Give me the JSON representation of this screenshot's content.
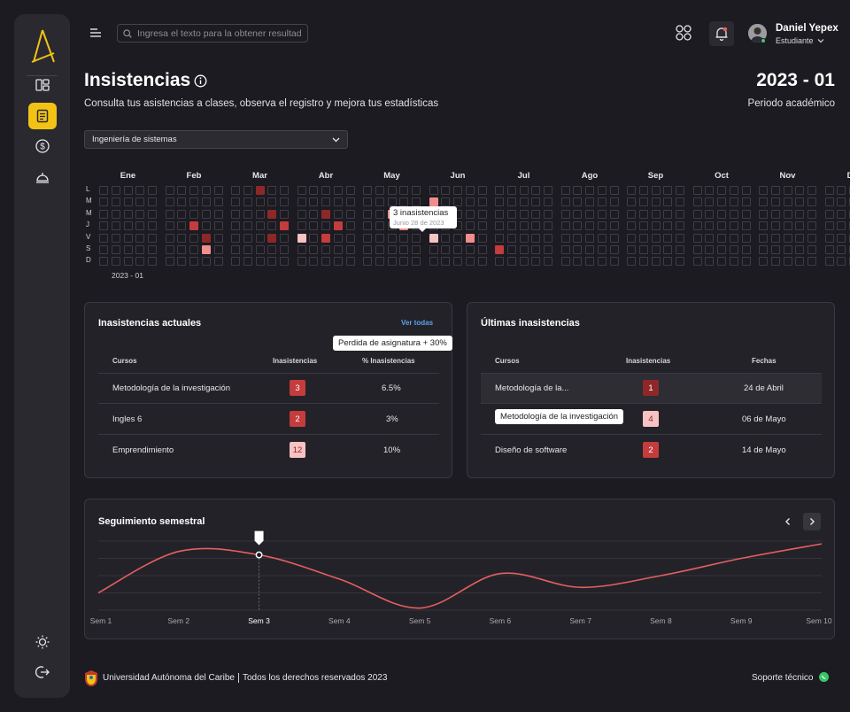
{
  "search": {
    "placeholder": "Ingresa el texto para la obtener resultados"
  },
  "user": {
    "name": "Daniel Yepex",
    "role": "Estudiante"
  },
  "header": {
    "title": "Insistencias",
    "subtitle": "Consulta tus asistencias a clases, observa el registro y mejora tus estadísticas",
    "period_value": "2023 - 01",
    "period_label": "Periodo académico"
  },
  "program_select": {
    "value": "Ingeniería de sistemas"
  },
  "heatmap": {
    "months": [
      "Ene",
      "Feb",
      "Mar",
      "Abr",
      "May",
      "Jun",
      "Jul",
      "Ago",
      "Sep",
      "Oct",
      "Nov",
      "Dic"
    ],
    "days": [
      "L",
      "M",
      "M",
      "J",
      "V",
      "S",
      "D"
    ],
    "year": "2023 - 01",
    "colors": {
      "dark": "#8e2828",
      "mid": "#c43c3c",
      "light": "#f08d8d",
      "pale": "#f6c2c2"
    },
    "highlighted": [
      {
        "col": 12,
        "row": 0,
        "level": "dark"
      },
      {
        "col": 25,
        "row": 1,
        "level": "light"
      },
      {
        "col": 13,
        "row": 2,
        "level": "dark"
      },
      {
        "col": 17,
        "row": 2,
        "level": "dark"
      },
      {
        "col": 22,
        "row": 2,
        "level": "light"
      },
      {
        "col": 7,
        "row": 3,
        "level": "mid"
      },
      {
        "col": 14,
        "row": 3,
        "level": "mid"
      },
      {
        "col": 18,
        "row": 3,
        "level": "mid"
      },
      {
        "col": 23,
        "row": 3,
        "level": "light"
      },
      {
        "col": 8,
        "row": 4,
        "level": "dark"
      },
      {
        "col": 13,
        "row": 4,
        "level": "dark"
      },
      {
        "col": 15,
        "row": 4,
        "level": "pale"
      },
      {
        "col": 17,
        "row": 4,
        "level": "mid"
      },
      {
        "col": 25,
        "row": 4,
        "level": "pale"
      },
      {
        "col": 28,
        "row": 4,
        "level": "light"
      },
      {
        "col": 8,
        "row": 5,
        "level": "light"
      },
      {
        "col": 30,
        "row": 5,
        "level": "mid"
      }
    ],
    "tooltip": {
      "title": "3 inasistencias",
      "date": "Junio 28 de 2023"
    }
  },
  "current_absences": {
    "title": "Inasistencias  actuales",
    "see_all": "Ver todas",
    "columns": [
      "Cursos",
      "Inasistencias",
      "% Inasistencias"
    ],
    "rows": [
      {
        "course": "Metodología de la investigación",
        "count": "3",
        "percent": "6.5%",
        "level": "mid"
      },
      {
        "course": "Ingles 6",
        "count": "2",
        "percent": "3%",
        "level": "mid"
      },
      {
        "course": "Emprendimiento",
        "count": "12",
        "percent": "10%",
        "level": "pale"
      }
    ],
    "tooltip": "Perdida de asignatura  + 30%"
  },
  "latest_absences": {
    "title": "Últimas inasistencias",
    "columns": [
      "Cursos",
      "Inasistencias",
      "Fechas"
    ],
    "rows": [
      {
        "course": "Metodología de la...",
        "count": "1",
        "date": "24 de Abril",
        "level": "dark"
      },
      {
        "course": "",
        "count": "4",
        "date": "06 de Mayo",
        "level": "pale"
      },
      {
        "course": "Diseño de software",
        "count": "2",
        "date": "14 de Mayo",
        "level": "mid"
      }
    ],
    "tooltip": "Metodología de la investigación"
  },
  "tracking": {
    "title": "Seguimiento semestral",
    "weeks": [
      "Sem 1",
      "Sem 2",
      "Sem 3",
      "Sem 4",
      "Sem 5",
      "Sem 6",
      "Sem 7",
      "Sem 8",
      "Sem 9",
      "Sem 10"
    ],
    "selected_week": "Sem 3",
    "line_color": "#e45f5f"
  },
  "chart_data": {
    "type": "line",
    "x": [
      "Sem 1",
      "Sem 2",
      "Sem 3",
      "Sem 4",
      "Sem 5",
      "Sem 6",
      "Sem 7",
      "Sem 8",
      "Sem 9",
      "Sem 10"
    ],
    "values": [
      0.25,
      0.85,
      0.8,
      0.45,
      0.03,
      0.53,
      0.33,
      0.5,
      0.75,
      0.96
    ],
    "ylim": [
      0,
      1
    ],
    "grid": true,
    "title": "Seguimiento semestral",
    "xlabel": "",
    "ylabel": ""
  },
  "footer": {
    "university": "Universidad Autónoma del Caribe",
    "rights": "Todos los derechos reservados  2023",
    "support": "Soporte técnico"
  }
}
